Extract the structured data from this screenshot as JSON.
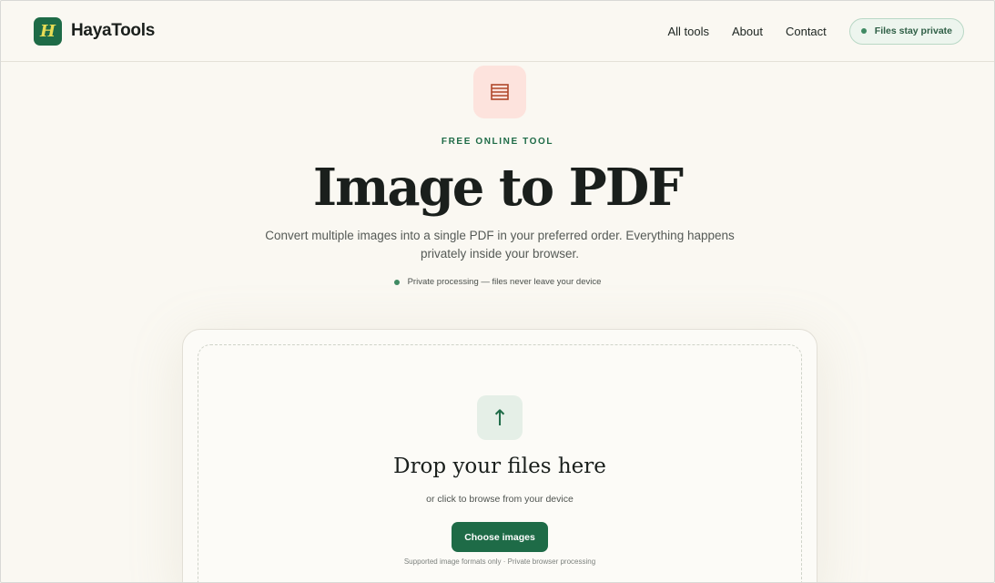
{
  "brand": {
    "logo_letter": "H",
    "name": "HayaTools"
  },
  "nav": {
    "items": [
      "All tools",
      "About",
      "Contact"
    ],
    "privacy_badge": "Files stay private"
  },
  "hero": {
    "eyebrow": "FREE ONLINE TOOL",
    "title": "Image to PDF",
    "subtitle": "Convert multiple images into a single PDF in your preferred order. Everything happens privately inside your browser.",
    "private_note": "Private processing — files never leave your device"
  },
  "upload": {
    "icon": "arrow-up-icon",
    "title": "Drop your files here",
    "subtitle": "or click to browse from your device",
    "button_label": "Choose images",
    "formats_note": "Supported image formats only · Private browser processing"
  },
  "colors": {
    "accent": "#1e6b47",
    "background": "#faf8f2",
    "tool_icon_bg": "#fde3dd",
    "tool_icon_fg": "#b0482a"
  }
}
